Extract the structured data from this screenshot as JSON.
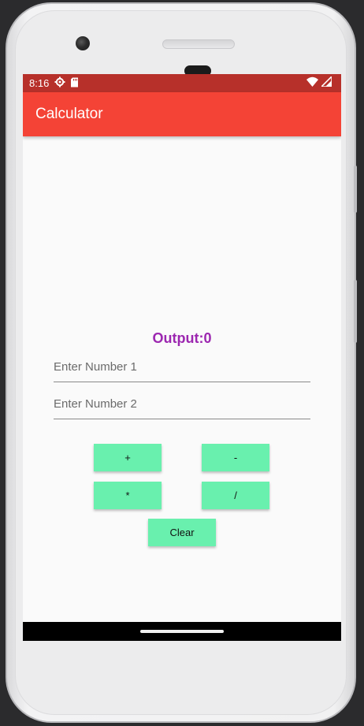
{
  "status_bar": {
    "time": "8:16",
    "color": "#b7302a"
  },
  "app_bar": {
    "title": "Calculator",
    "color": "#f44336"
  },
  "main": {
    "output_text": "Output:0",
    "output_color": "#9c27b0",
    "input1": {
      "placeholder": "Enter Number 1",
      "value": ""
    },
    "input2": {
      "placeholder": "Enter Number 2",
      "value": ""
    },
    "buttons": {
      "add": "+",
      "subtract": "-",
      "multiply": "*",
      "divide": "/",
      "clear": "Clear"
    },
    "button_color": "#69f0ae"
  },
  "icons": {
    "status_left": [
      "settings-icon",
      "sd-card-icon"
    ],
    "status_right": [
      "wifi-icon",
      "signal-icon"
    ]
  }
}
